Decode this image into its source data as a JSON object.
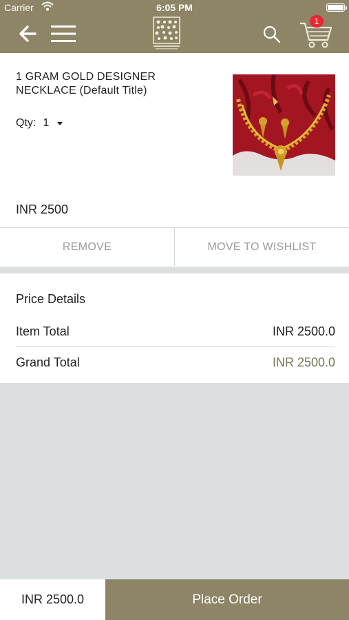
{
  "status_bar": {
    "carrier": "Carrier",
    "time": "6:05 PM",
    "wifi_icon": "wifi-icon",
    "battery_icon": "battery-icon"
  },
  "header": {
    "background_color": "#8e8566",
    "back_icon": "arrow-left-icon",
    "menu_icon": "hamburger-icon",
    "logo_icon": "brand-logo",
    "search_icon": "search-icon",
    "cart_icon": "cart-icon",
    "cart_count": "1",
    "badge_color": "#e8272e"
  },
  "product": {
    "title": "1 GRAM GOLD DESIGNER NECKLACE (Default Title)",
    "qty_label": "Qty:",
    "qty_value": "1",
    "price": "INR 2500",
    "image_icon": "necklace-product-image"
  },
  "actions": {
    "remove_label": "REMOVE",
    "wishlist_label": "MOVE TO WISHLIST"
  },
  "price_details": {
    "heading": "Price Details",
    "item_total_label": "Item Total",
    "item_total_value": "INR 2500.0",
    "grand_total_label": "Grand Total",
    "grand_total_value": "INR 2500.0"
  },
  "footer": {
    "total": "INR 2500.0",
    "place_order_label": "Place Order"
  }
}
